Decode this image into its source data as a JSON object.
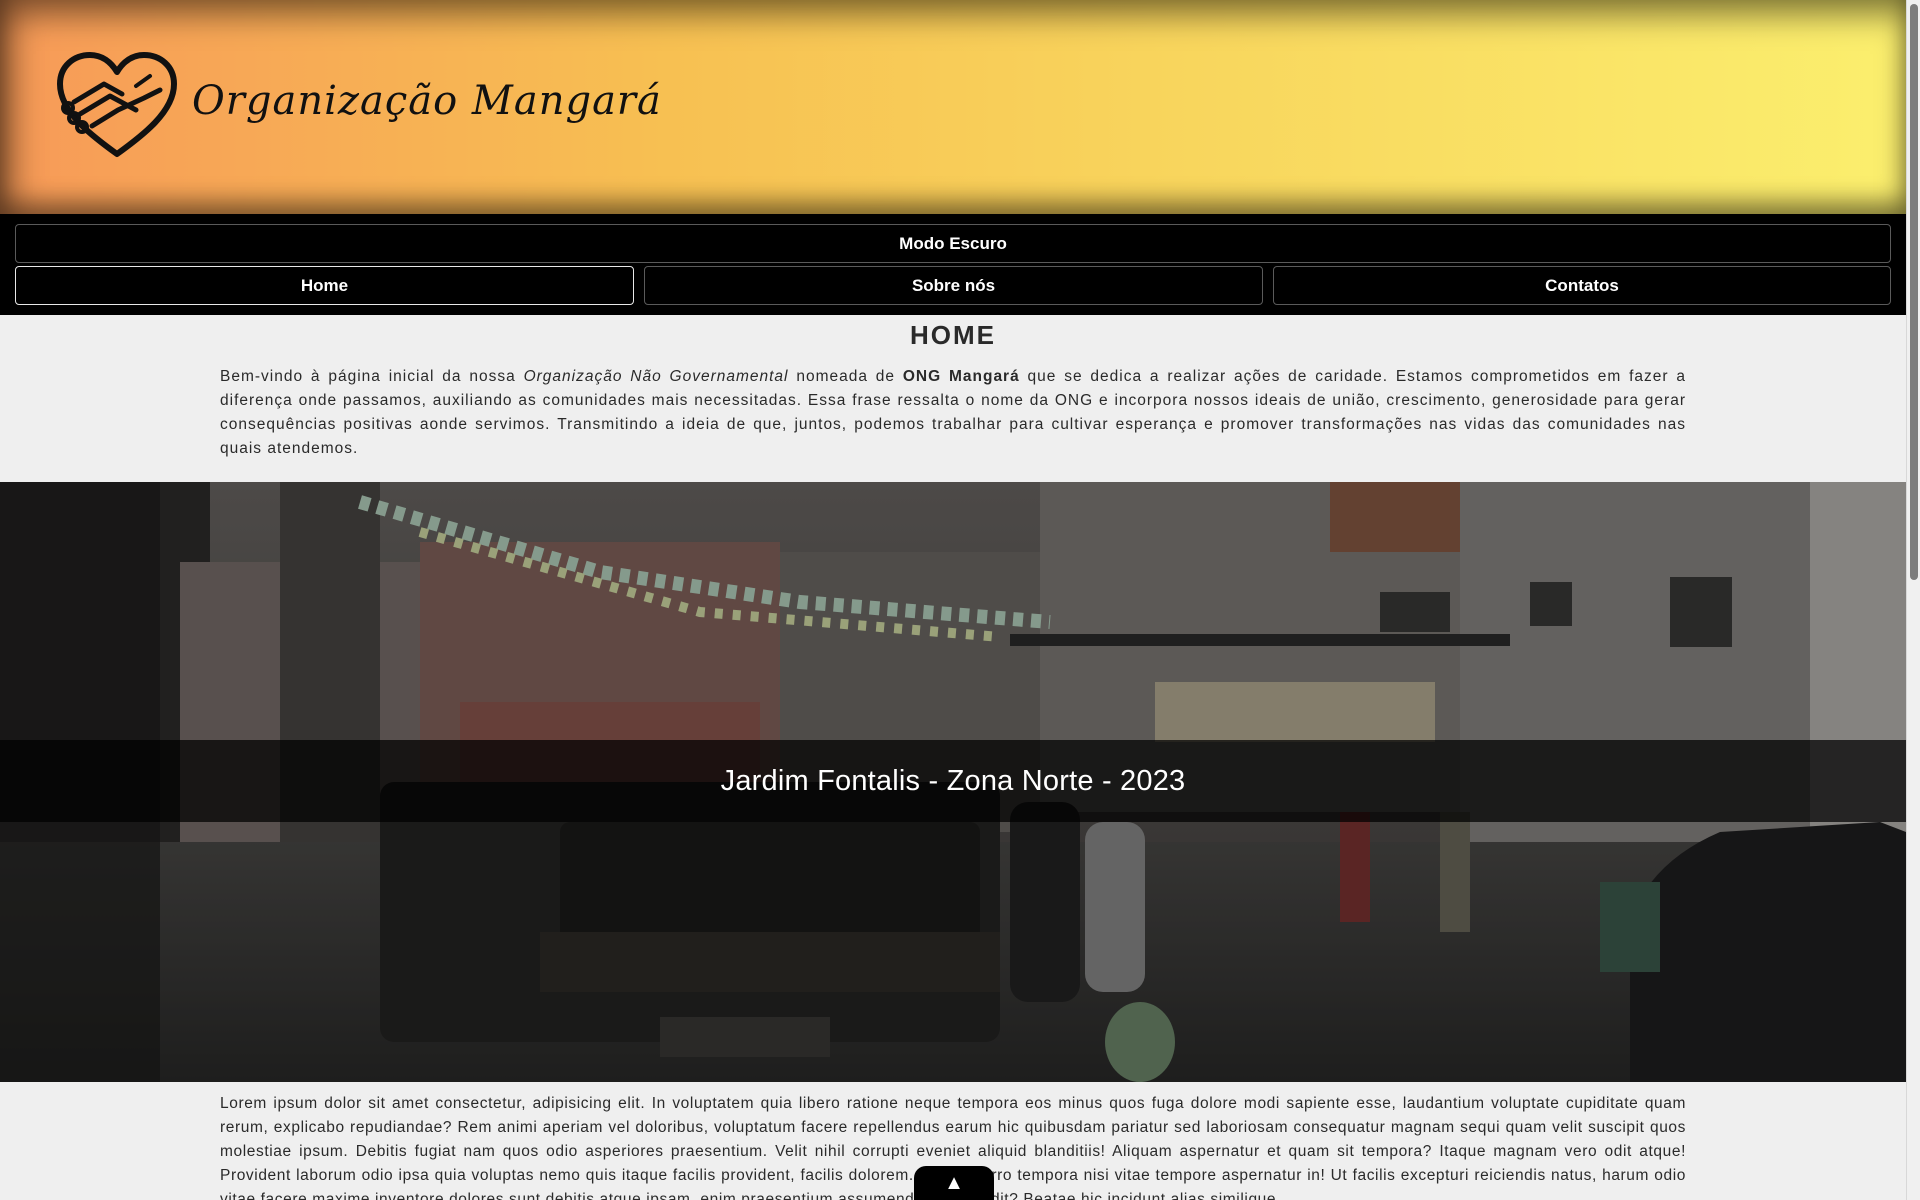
{
  "header": {
    "brand_name": "Organização Mangará",
    "logo_icon": "heart-handshake-icon"
  },
  "nav": {
    "dark_mode_label": "Modo Escuro",
    "items": [
      {
        "label": "Home",
        "active": true
      },
      {
        "label": "Sobre nós",
        "active": false
      },
      {
        "label": "Contatos",
        "active": false
      }
    ]
  },
  "main": {
    "title": "HOME",
    "intro": {
      "part1": "Bem-vindo à página inicial da nossa ",
      "italic": "Organização Não Governamental",
      "part2": " nomeada de ",
      "bold": "ONG Mangará",
      "part3": " que se dedica a realizar ações de caridade. Estamos comprometidos em fazer a diferença onde passamos, auxiliando as comunidades mais necessitadas. Essa frase ressalta o nome da ONG e incorpora nossos ideais de união, crescimento, generosidade para gerar consequências positivas aonde servimos. Transmitindo a ideia de que, juntos, podemos trabalhar para cultivar esperança e promover transformações nas vidas das comunidades nas quais atendemos."
    },
    "hero_caption": "Jardim Fontalis - Zona Norte - 2023",
    "lorem": "Lorem ipsum dolor sit amet consectetur, adipisicing elit. In voluptatem quia libero ratione neque tempora eos minus quos fuga dolore modi sapiente esse, laudantium voluptate cupiditate quam rerum, explicabo repudiandae? Rem animi aperiam vel doloribus, voluptatum facere repellendus earum hic quibusdam pariatur sed laboriosam consequatur magnam sequi quam velit suscipit quos molestiae ipsum. Debitis fugiat nam quos odio asperiores praesentium. Velit nihil corrupti eveniet aliquid blanditiis! Aliquam aspernatur et quam sit tempora? Itaque magnam vero odit atque! Provident laborum odio ipsa quia voluptas nemo quis itaque facilis provident, facilis dolorem. Neque porro tempora nisi vitae tempore aspernatur in! Ut facilis excepturi reiciendis natus, harum odio vitae facere maxime inventore dolores sunt debitis atque ipsam, enim praesentium assumenda vel impedit? Beatae hic incidunt alias similique."
  },
  "back_to_top": {
    "symbol": "▲",
    "icon": "arrow-up-icon"
  },
  "colors": {
    "header_gradient_start": "#f79a58",
    "header_gradient_end": "#fbef6e",
    "nav_background": "#000000",
    "page_background": "#efefef"
  }
}
